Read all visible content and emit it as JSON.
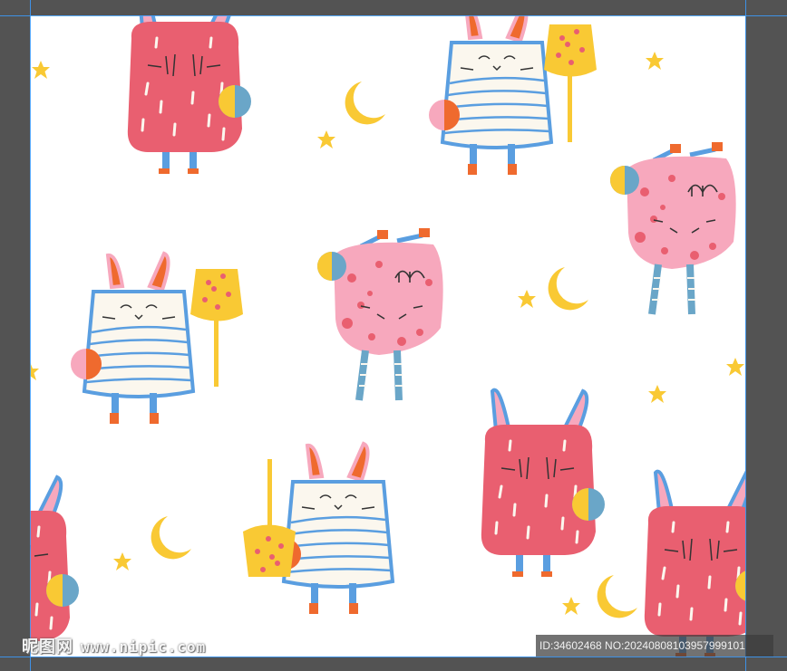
{
  "watermark": {
    "logo_text": "昵图网",
    "site_text": "www.nipic.com",
    "image_id_text": "ID:34602468 NO:20240808103957999101"
  },
  "colors": {
    "workspace_bg": "#535353",
    "artboard_bg": "#ffffff",
    "guide": "#3b9cff",
    "bunny_pink": "#e95f70",
    "monster_pink": "#f7a8bd",
    "mummy_blue": "#5a9ee0",
    "cream": "#fbf7ee",
    "moon_yellow": "#f9c934",
    "orange": "#ef6a2e",
    "grey_blue": "#6aa6c8"
  },
  "pattern": {
    "motifs": [
      "pink-bunny",
      "mummy-bunny",
      "pink-monster",
      "moon",
      "star",
      "broom"
    ]
  }
}
